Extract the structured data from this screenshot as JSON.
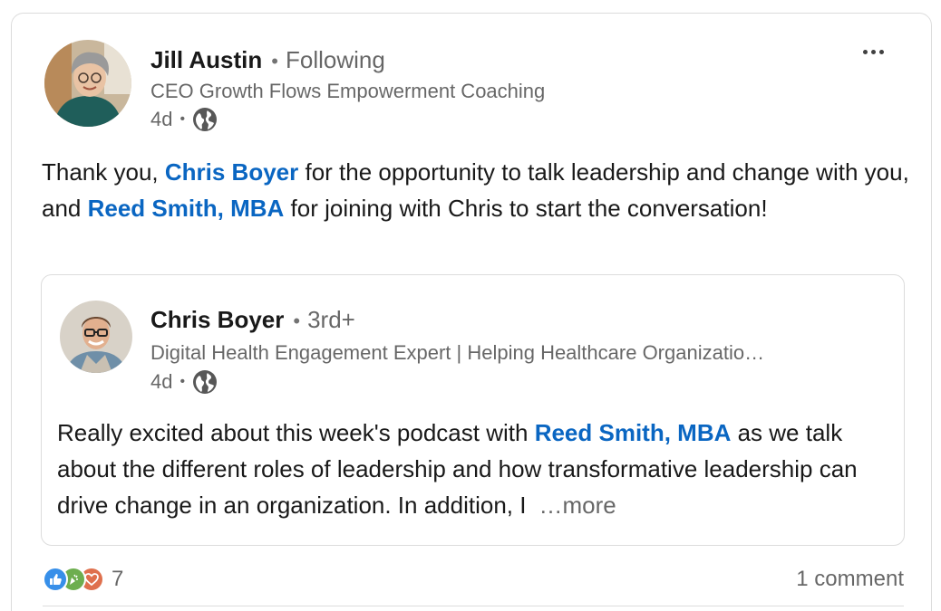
{
  "post": {
    "author_name": "Jill Austin",
    "relation_separator": "•",
    "relation": "Following",
    "headline": "CEO Growth Flows Empowerment Coaching",
    "time": "4d",
    "meta_separator": "•",
    "visibility_icon": "globe-icon",
    "menu_icon": "more-horizontal-icon",
    "text": {
      "part1": "Thank you, ",
      "mention1": "Chris Boyer",
      "part2": " for the opportunity to talk leadership and change with you, and ",
      "mention2": "Reed Smith, MBA",
      "part3": " for joining with Chris to start the conversation!"
    }
  },
  "shared_post": {
    "author_name": "Chris Boyer",
    "relation_separator": "•",
    "relation": "3rd+",
    "headline": "Digital Health Engagement Expert | Helping Healthcare Organizatio…",
    "time": "4d",
    "meta_separator": "•",
    "visibility_icon": "globe-icon",
    "text": {
      "part1": "Really excited about this week's podcast with ",
      "mention1": "Reed Smith, MBA",
      "part2": " as we talk about the different roles of leadership and how transformative leadership can drive change in an organization. In addition, I",
      "more": "…more"
    }
  },
  "social": {
    "reaction_icons": [
      "like-icon",
      "celebrate-icon",
      "love-icon"
    ],
    "reaction_count": "7",
    "comments": "1 comment"
  },
  "colors": {
    "mention": "#0a66c2",
    "like": "#378fe9",
    "celebrate": "#44712e",
    "love": "#df704d"
  }
}
